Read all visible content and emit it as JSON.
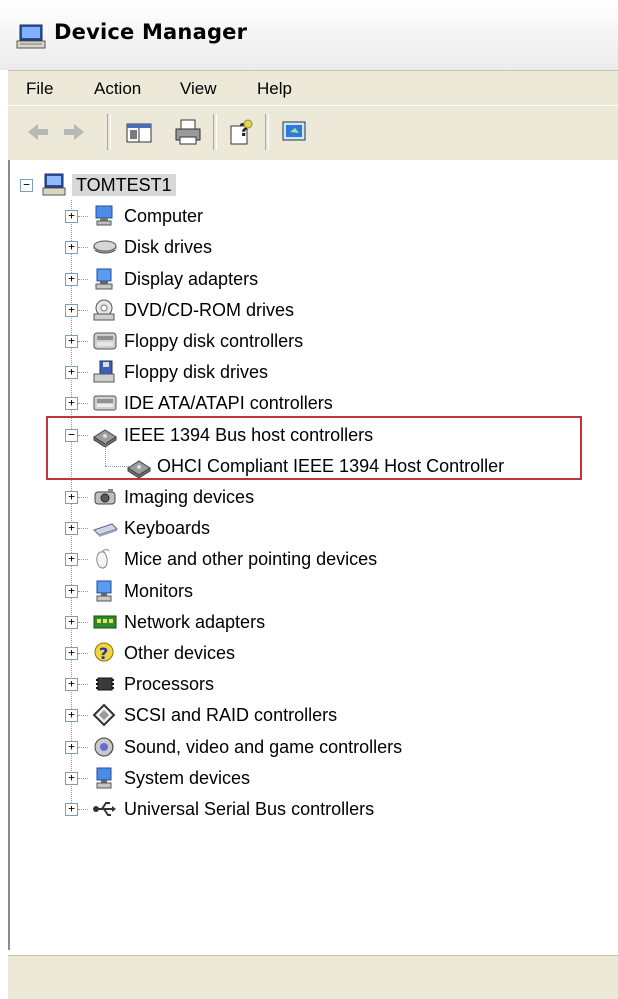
{
  "window": {
    "title": "Device Manager",
    "icon": "computer-icon"
  },
  "menu": [
    "File",
    "Action",
    "View",
    "Help"
  ],
  "toolbar": {
    "buttons": [
      "back-arrow-icon",
      "forward-arrow-icon",
      "show-hide-console-tree-icon",
      "print-icon",
      "help-icon",
      "properties-icon"
    ]
  },
  "tree": {
    "root": {
      "label": "TOMTEST1",
      "icon": "computer-icon",
      "expanded": true
    },
    "categories": [
      {
        "label": "Computer",
        "icon": "computer-category-icon",
        "expanded": false
      },
      {
        "label": "Disk drives",
        "icon": "disk-drive-icon",
        "expanded": false
      },
      {
        "label": "Display adapters",
        "icon": "display-adapter-icon",
        "expanded": false
      },
      {
        "label": "DVD/CD-ROM drives",
        "icon": "cdrom-icon",
        "expanded": false
      },
      {
        "label": "Floppy disk controllers",
        "icon": "floppy-controller-icon",
        "expanded": false
      },
      {
        "label": "Floppy disk drives",
        "icon": "floppy-drive-icon",
        "expanded": false
      },
      {
        "label": "IDE ATA/ATAPI controllers",
        "icon": "ide-controller-icon",
        "expanded": false
      },
      {
        "label": "IEEE 1394 Bus host controllers",
        "icon": "ieee1394-icon",
        "expanded": true,
        "children": [
          {
            "label": "OHCI Compliant IEEE 1394 Host Controller",
            "icon": "ieee1394-icon"
          }
        ]
      },
      {
        "label": "Imaging devices",
        "icon": "camera-icon",
        "expanded": false
      },
      {
        "label": "Keyboards",
        "icon": "keyboard-icon",
        "expanded": false
      },
      {
        "label": "Mice and other pointing devices",
        "icon": "mouse-icon",
        "expanded": false
      },
      {
        "label": "Monitors",
        "icon": "monitor-icon",
        "expanded": false
      },
      {
        "label": "Network adapters",
        "icon": "network-adapter-icon",
        "expanded": false
      },
      {
        "label": "Other devices",
        "icon": "unknown-device-icon",
        "expanded": false
      },
      {
        "label": "Processors",
        "icon": "processor-icon",
        "expanded": false
      },
      {
        "label": "SCSI and RAID controllers",
        "icon": "scsi-icon",
        "expanded": false
      },
      {
        "label": "Sound, video and game controllers",
        "icon": "sound-icon",
        "expanded": false
      },
      {
        "label": "System devices",
        "icon": "system-device-icon",
        "expanded": false
      },
      {
        "label": "Universal Serial Bus controllers",
        "icon": "usb-icon",
        "expanded": false
      }
    ]
  },
  "highlight": {
    "color": "#c0353a"
  },
  "statusbar": {
    "text": ""
  }
}
